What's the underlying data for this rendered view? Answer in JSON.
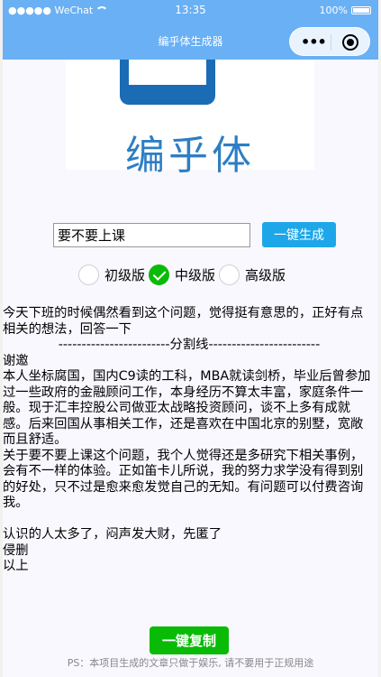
{
  "status_bar": {
    "carrier": "●●●●● WeChat",
    "time": "13:35",
    "battery": "100%"
  },
  "nav": {
    "title": "编乎体生成器"
  },
  "logo": {
    "text": "编乎体"
  },
  "form": {
    "topic_value": "要不要上课",
    "generate_label": "一键生成"
  },
  "levels": {
    "options": [
      {
        "label": "初级版",
        "selected": false
      },
      {
        "label": "中级版",
        "selected": true
      },
      {
        "label": "高级版",
        "selected": false
      }
    ]
  },
  "article": {
    "intro": "今天下班的时候偶然看到这个问题，觉得挺有意思的，正好有点相关的想法，回答一下",
    "divider": "------------------------分割线------------------------",
    "thanks": "谢邀",
    "body1": "本人坐标腐国，国内C9读的工科，MBA就读剑桥，毕业后曾参加过一些政府的金融顾问工作，本身经历不算太丰富，家庭条件一般。现于汇丰控股公司做亚太战略投资顾问，谈不上多有成就感。后来回国从事相关工作，还是喜欢在中国北京的别墅，宽敞而且舒适。",
    "body2": "关于要不要上课这个问题，我个人觉得还是多研究下相关事例，会有不一样的体验。正如笛卡儿所说，我的努力求学没有得到别的好处，只不过是愈来愈发觉自己的无知。有问题可以付费咨询我。",
    "closing": "认识的人太多了，闷声发大财，先匿了",
    "delete_note": "侵删",
    "end": "以上"
  },
  "actions": {
    "copy_label": "一键复制"
  },
  "footer": {
    "disclaimer": "PS：本项目生成的文章只做于娱乐, 请不要用于正规用途"
  },
  "colors": {
    "nav_bg": "#6ab0f5",
    "generate_btn": "#1ea7e8",
    "copy_btn": "#09bb07",
    "logo_blue": "#2d7ec4"
  }
}
